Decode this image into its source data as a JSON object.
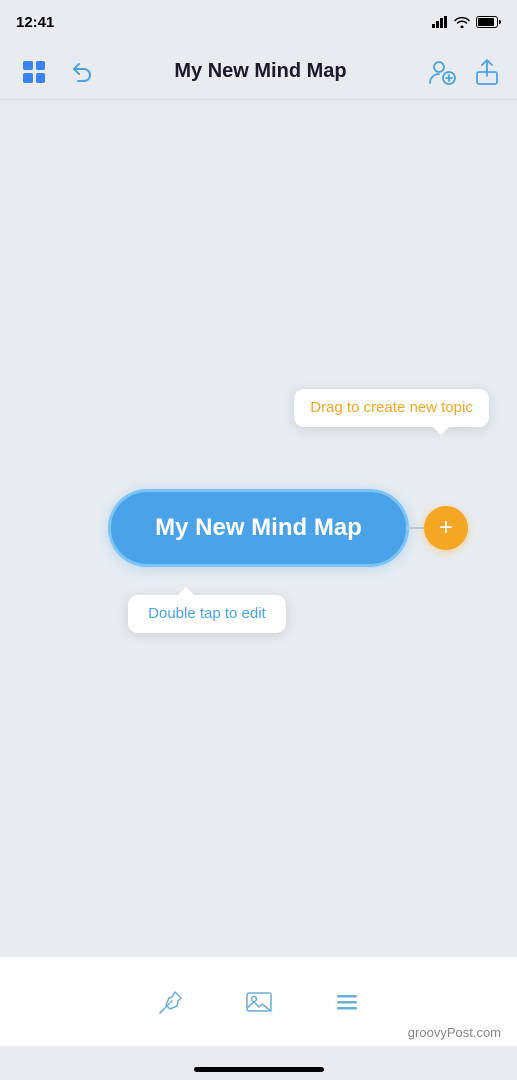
{
  "status": {
    "time": "12:41"
  },
  "nav": {
    "title": "My New Mind Map",
    "undo_label": "undo",
    "add_person_label": "add person",
    "share_label": "share"
  },
  "canvas": {
    "center_node_text": "My New Mind Map",
    "tooltip_drag": "Drag to create new topic",
    "tooltip_edit": "Double tap to edit"
  },
  "toolbar": {
    "pin_icon": "pin",
    "image_icon": "image",
    "menu_icon": "menu"
  },
  "watermark": "groovyPost.com",
  "colors": {
    "accent_blue": "#4aa3e8",
    "accent_orange": "#f5a623",
    "node_border": "#7ec4f5"
  }
}
